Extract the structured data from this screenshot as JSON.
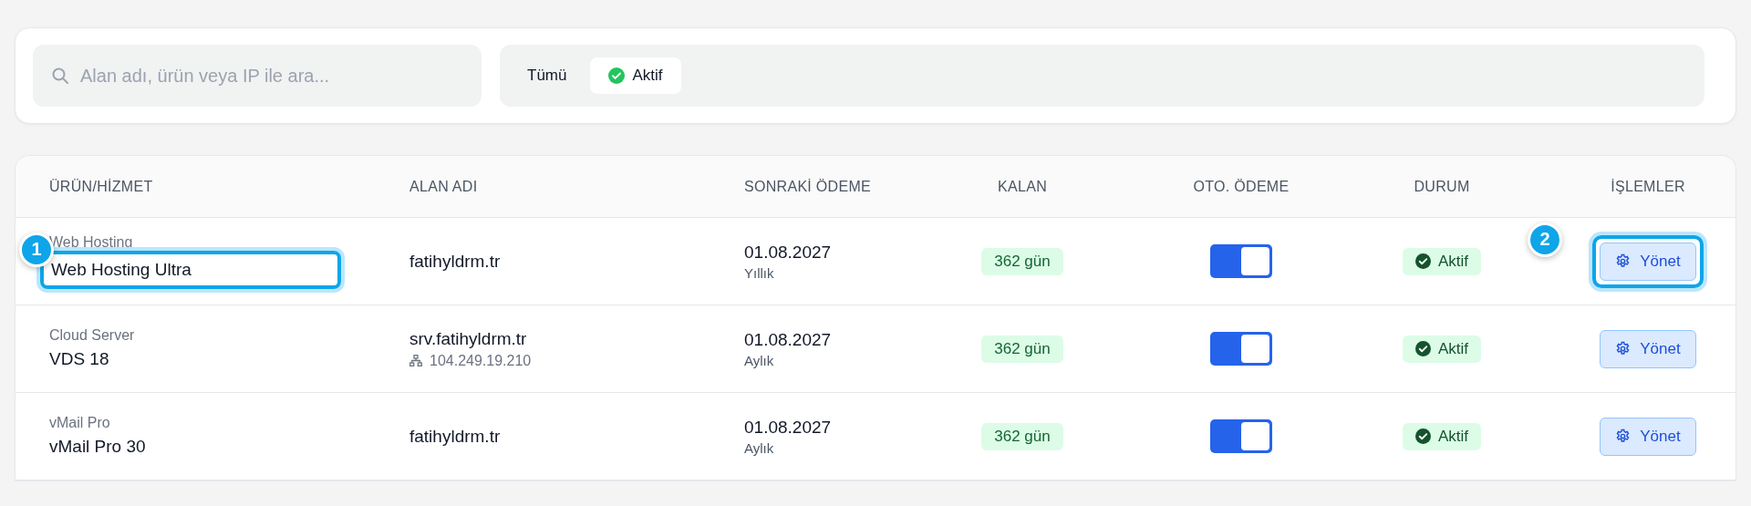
{
  "filters": {
    "search": {
      "placeholder": "Alan adı, ürün veya IP ile ara..."
    },
    "tabs": [
      {
        "label": "Tümü",
        "selected": false,
        "icon": false
      },
      {
        "label": "Aktif",
        "selected": true,
        "icon": true
      }
    ]
  },
  "table": {
    "columns": [
      "ÜRÜN/HİZMET",
      "ALAN ADI",
      "SONRAKİ ÖDEME",
      "KALAN",
      "OTO. ÖDEME",
      "DURUM",
      "İŞLEMLER"
    ],
    "rows": [
      {
        "category": "Web Hosting",
        "name": "Web Hosting Ultra",
        "domain": "fatihyldrm.tr",
        "date": "01.08.2027",
        "period": "Yıllık",
        "remaining": "362 gün",
        "auto_pay": true,
        "status": "Aktif",
        "action": "Yönet",
        "product_callout": "1",
        "action_callout": "2"
      },
      {
        "category": "Cloud Server",
        "name": "VDS 18",
        "domain": "srv.fatihyldrm.tr",
        "ip": "104.249.19.210",
        "date": "01.08.2027",
        "period": "Aylık",
        "remaining": "362 gün",
        "auto_pay": true,
        "status": "Aktif",
        "action": "Yönet"
      },
      {
        "category": "vMail Pro",
        "name": "vMail Pro 30",
        "domain": "fatihyldrm.tr",
        "date": "01.08.2027",
        "period": "Aylık",
        "remaining": "362 gün",
        "auto_pay": true,
        "status": "Aktif",
        "action": "Yönet"
      }
    ]
  }
}
